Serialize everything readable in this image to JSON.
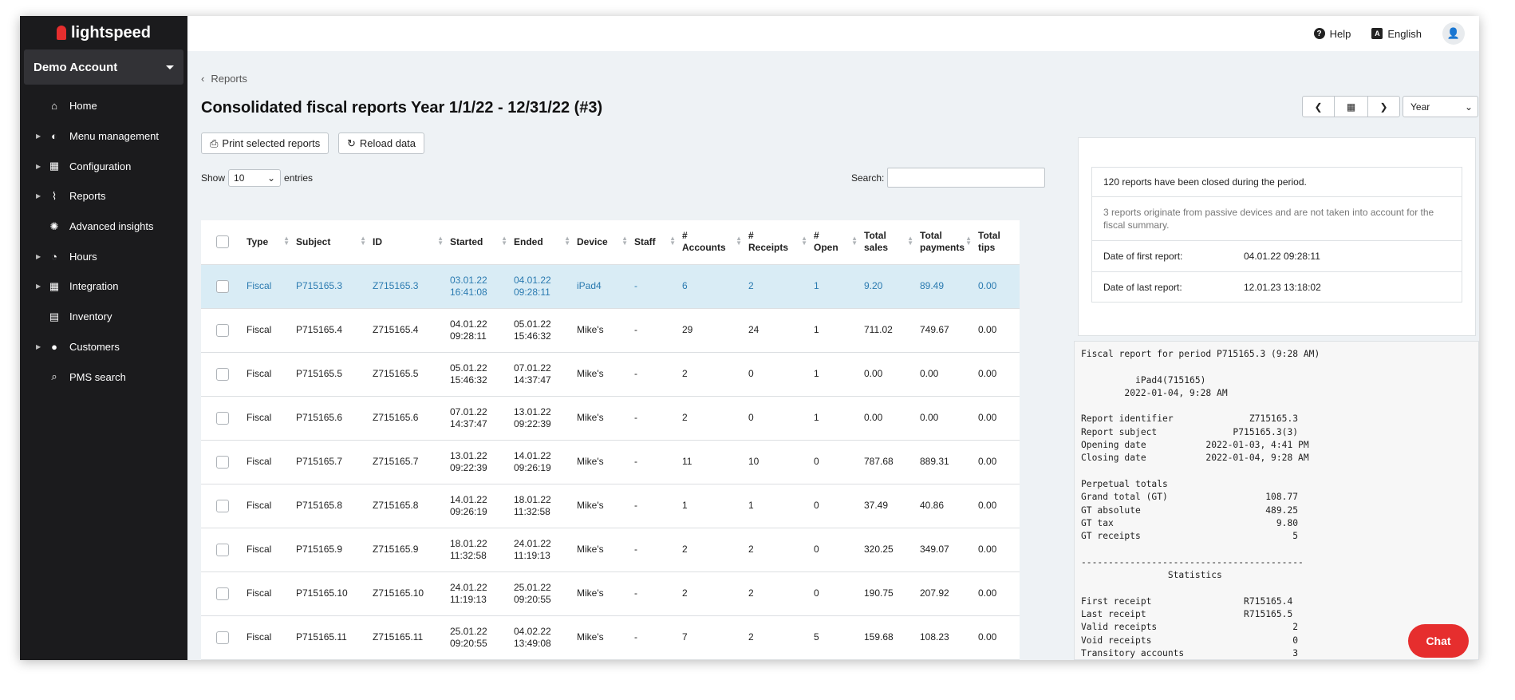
{
  "app": {
    "logo_text": "lightspeed",
    "account": "Demo Account"
  },
  "sidebar": {
    "items": [
      {
        "label": "Home",
        "icon": "home-icon",
        "glyph": "⌂",
        "expandable": false
      },
      {
        "label": "Menu management",
        "icon": "menu-icon",
        "glyph": "◐",
        "expandable": true
      },
      {
        "label": "Configuration",
        "icon": "grid-icon",
        "glyph": "▦",
        "expandable": true
      },
      {
        "label": "Reports",
        "icon": "chart-icon",
        "glyph": "⌇",
        "expandable": true
      },
      {
        "label": "Advanced insights",
        "icon": "lightbulb-icon",
        "glyph": "✺",
        "expandable": false
      },
      {
        "label": "Hours",
        "icon": "clock-icon",
        "glyph": "◔",
        "expandable": true
      },
      {
        "label": "Integration",
        "icon": "puzzle-icon",
        "glyph": "▦",
        "expandable": true
      },
      {
        "label": "Inventory",
        "icon": "box-icon",
        "glyph": "▤",
        "expandable": false
      },
      {
        "label": "Customers",
        "icon": "person-icon",
        "glyph": "●",
        "expandable": true
      },
      {
        "label": "PMS search",
        "icon": "search-icon",
        "glyph": "⌕",
        "expandable": false
      }
    ]
  },
  "topbar": {
    "help": "Help",
    "language": "English"
  },
  "breadcrumb": "Reports",
  "title": "Consolidated fiscal reports Year 1/1/22 - 12/31/22 (#3)",
  "buttons": {
    "print": "Print selected reports",
    "reload": "Reload data"
  },
  "period": {
    "selected": "Year"
  },
  "table_controls": {
    "show_label": "Show",
    "entries_value": "10",
    "entries_label": "entries",
    "search_label": "Search:"
  },
  "table": {
    "columns": [
      "Type",
      "Subject",
      "ID",
      "Started",
      "Ended",
      "Device",
      "Staff",
      "# Accounts",
      "# Receipts",
      "# Open",
      "Total sales",
      "Total payments",
      "Total tips"
    ],
    "rows": [
      {
        "type": "Fiscal",
        "subject": "P715165.3",
        "id": "Z715165.3",
        "started_date": "03.01.22",
        "started_time": "16:41:08",
        "ended_date": "04.01.22",
        "ended_time": "09:28:11",
        "device": "iPad4",
        "staff": "-",
        "accounts": "6",
        "receipts": "2",
        "open": "1",
        "sales": "9.20",
        "payments": "89.49",
        "tips": "0.00",
        "selected": true
      },
      {
        "type": "Fiscal",
        "subject": "P715165.4",
        "id": "Z715165.4",
        "started_date": "04.01.22",
        "started_time": "09:28:11",
        "ended_date": "05.01.22",
        "ended_time": "15:46:32",
        "device": "Mike's",
        "staff": "-",
        "accounts": "29",
        "receipts": "24",
        "open": "1",
        "sales": "711.02",
        "payments": "749.67",
        "tips": "0.00",
        "selected": false
      },
      {
        "type": "Fiscal",
        "subject": "P715165.5",
        "id": "Z715165.5",
        "started_date": "05.01.22",
        "started_time": "15:46:32",
        "ended_date": "07.01.22",
        "ended_time": "14:37:47",
        "device": "Mike's",
        "staff": "-",
        "accounts": "2",
        "receipts": "0",
        "open": "1",
        "sales": "0.00",
        "payments": "0.00",
        "tips": "0.00",
        "selected": false
      },
      {
        "type": "Fiscal",
        "subject": "P715165.6",
        "id": "Z715165.6",
        "started_date": "07.01.22",
        "started_time": "14:37:47",
        "ended_date": "13.01.22",
        "ended_time": "09:22:39",
        "device": "Mike's",
        "staff": "-",
        "accounts": "2",
        "receipts": "0",
        "open": "1",
        "sales": "0.00",
        "payments": "0.00",
        "tips": "0.00",
        "selected": false
      },
      {
        "type": "Fiscal",
        "subject": "P715165.7",
        "id": "Z715165.7",
        "started_date": "13.01.22",
        "started_time": "09:22:39",
        "ended_date": "14.01.22",
        "ended_time": "09:26:19",
        "device": "Mike's",
        "staff": "-",
        "accounts": "11",
        "receipts": "10",
        "open": "0",
        "sales": "787.68",
        "payments": "889.31",
        "tips": "0.00",
        "selected": false
      },
      {
        "type": "Fiscal",
        "subject": "P715165.8",
        "id": "Z715165.8",
        "started_date": "14.01.22",
        "started_time": "09:26:19",
        "ended_date": "18.01.22",
        "ended_time": "11:32:58",
        "device": "Mike's",
        "staff": "-",
        "accounts": "1",
        "receipts": "1",
        "open": "0",
        "sales": "37.49",
        "payments": "40.86",
        "tips": "0.00",
        "selected": false
      },
      {
        "type": "Fiscal",
        "subject": "P715165.9",
        "id": "Z715165.9",
        "started_date": "18.01.22",
        "started_time": "11:32:58",
        "ended_date": "24.01.22",
        "ended_time": "11:19:13",
        "device": "Mike's",
        "staff": "-",
        "accounts": "2",
        "receipts": "2",
        "open": "0",
        "sales": "320.25",
        "payments": "349.07",
        "tips": "0.00",
        "selected": false
      },
      {
        "type": "Fiscal",
        "subject": "P715165.10",
        "id": "Z715165.10",
        "started_date": "24.01.22",
        "started_time": "11:19:13",
        "ended_date": "25.01.22",
        "ended_time": "09:20:55",
        "device": "Mike's",
        "staff": "-",
        "accounts": "2",
        "receipts": "2",
        "open": "0",
        "sales": "190.75",
        "payments": "207.92",
        "tips": "0.00",
        "selected": false
      },
      {
        "type": "Fiscal",
        "subject": "P715165.11",
        "id": "Z715165.11",
        "started_date": "25.01.22",
        "started_time": "09:20:55",
        "ended_date": "04.02.22",
        "ended_time": "13:49:08",
        "device": "Mike's",
        "staff": "-",
        "accounts": "7",
        "receipts": "2",
        "open": "5",
        "sales": "159.68",
        "payments": "108.23",
        "tips": "0.00",
        "selected": false
      }
    ]
  },
  "summary": {
    "closed_note": "120 reports have been closed during the period.",
    "passive_note": "3 reports originate from passive devices and are not taken into account for the fiscal summary.",
    "first_label": "Date of first report:",
    "first_value": "04.01.22 09:28:11",
    "last_label": "Date of last report:",
    "last_value": "12.01.23 13:18:02"
  },
  "fiscal_report_text": "Fiscal report for period P715165.3 (9:28 AM)\n\n          iPad4(715165)\n        2022-01-04, 9:28 AM\n\nReport identifier              Z715165.3\nReport subject              P715165.3(3)\nOpening date           2022-01-03, 4:41 PM\nClosing date           2022-01-04, 9:28 AM\n\nPerpetual totals\nGrand total (GT)                  108.77\nGT absolute                       489.25\nGT tax                              9.80\nGT receipts                            5\n\n-----------------------------------------\n                Statistics\n\nFirst receipt                 R715165.4\nLast receipt                  R715165.5\nValid receipts                         2\nVoid receipts                          0\nTransitory accounts                    3",
  "chat": "Chat",
  "colors": {
    "sidebar": "#1b1b1d",
    "selected_row": "#d9ecf5",
    "link": "#2a7ab0",
    "chat": "#e62e2e"
  }
}
